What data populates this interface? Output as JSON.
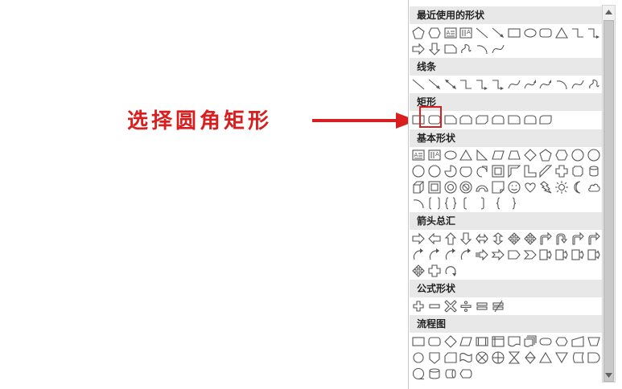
{
  "annotation": {
    "text": "选择圆角矩形",
    "color": "#d81e1e"
  },
  "panel": {
    "sections": [
      {
        "title": "最近使用的形状",
        "rows": [
          [
            "pentagon-icon",
            "hexagon-icon",
            "text-box-icon",
            "vertical-text-box-icon",
            "line-icon",
            "arrow-line-icon",
            "rectangle-icon",
            "oval-icon",
            "rounded-rectangle-icon",
            "triangle-icon",
            "elbow-connector-icon",
            "elbow-arrow-connector-icon"
          ],
          [
            "right-arrow-icon",
            "down-arrow-icon",
            "snip-corner-rectangle-icon",
            "scribble-icon",
            "arc-icon",
            "freeform-curve-icon"
          ]
        ]
      },
      {
        "title": "线条",
        "rows": [
          [
            "line-icon",
            "arrow-line-icon",
            "double-arrow-line-icon",
            "elbow-connector-icon",
            "elbow-arrow-connector-icon",
            "elbow-double-arrow-icon",
            "curved-connector-icon",
            "curved-arrow-connector-icon",
            "curved-double-arrow-icon",
            "curve-icon",
            "freeform-icon",
            "scribble-icon"
          ]
        ]
      },
      {
        "title": "矩形",
        "rows": [
          [
            "rectangle-icon",
            "rounded-rectangle-icon",
            "snip-single-corner-icon",
            "snip-same-side-icon",
            "snip-diagonal-icon",
            "snip-round-corner-icon",
            "round-single-corner-icon",
            "round-same-side-icon",
            "round-diagonal-icon"
          ]
        ]
      },
      {
        "title": "基本形状",
        "rows": [
          [
            "text-box-icon",
            "vertical-text-box-icon",
            "oval-icon",
            "isosceles-triangle-icon",
            "right-triangle-icon",
            "parallelogram-icon",
            "trapezoid-icon",
            "diamond-icon",
            "pentagon-icon",
            "hexagon-icon",
            "heptagon-icon",
            "octagon-icon"
          ],
          [
            "decagon-icon",
            "dodecagon-icon",
            "pie-icon",
            "chord-icon",
            "teardrop-icon",
            "frame-icon",
            "half-frame-icon",
            "l-shape-icon",
            "diagonal-stripe-icon",
            "cross-icon",
            "plaque-icon",
            "can-icon"
          ],
          [
            "cube-icon",
            "bevel-icon",
            "donut-icon",
            "no-symbol-icon",
            "block-arc-icon",
            "folded-corner-icon",
            "smiley-face-icon",
            "heart-icon",
            "lightning-bolt-icon",
            "sun-icon",
            "moon-icon",
            "cloud-icon"
          ],
          [
            "arc-icon",
            "double-bracket-icon",
            "double-brace-icon",
            "left-bracket-icon",
            "right-bracket-icon",
            "left-brace-icon",
            "right-brace-icon"
          ]
        ]
      },
      {
        "title": "箭头总汇",
        "rows": [
          [
            "right-arrow-icon",
            "left-arrow-icon",
            "up-arrow-icon",
            "down-arrow-icon",
            "left-right-arrow-icon",
            "up-down-arrow-icon",
            "quad-arrow-icon",
            "left-right-up-arrow-icon",
            "bent-arrow-icon",
            "u-turn-arrow-icon",
            "left-up-arrow-icon",
            "bent-up-arrow-icon"
          ],
          [
            "curved-right-arrow-icon",
            "curved-left-arrow-icon",
            "curved-up-arrow-icon",
            "curved-down-arrow-icon",
            "striped-right-arrow-icon",
            "notched-right-arrow-icon",
            "pentagon-arrow-icon",
            "chevron-icon",
            "right-arrow-callout-icon",
            "down-arrow-callout-icon",
            "left-arrow-callout-icon",
            "up-arrow-callout-icon"
          ],
          [
            "left-right-arrow-callout-icon",
            "quad-arrow-callout-icon",
            "circular-arrow-icon"
          ]
        ]
      },
      {
        "title": "公式形状",
        "rows": [
          [
            "plus-icon",
            "minus-icon",
            "multiply-icon",
            "divide-icon",
            "equal-icon",
            "not-equal-icon"
          ]
        ]
      },
      {
        "title": "流程图",
        "rows": [
          [
            "flowchart-process-icon",
            "flowchart-alternate-process-icon",
            "flowchart-decision-icon",
            "flowchart-data-icon",
            "flowchart-predefined-process-icon",
            "flowchart-internal-storage-icon",
            "flowchart-document-icon",
            "flowchart-multidocument-icon",
            "flowchart-terminator-icon",
            "flowchart-preparation-icon",
            "flowchart-manual-input-icon",
            "flowchart-manual-operation-icon"
          ],
          [
            "flowchart-connector-icon",
            "flowchart-offpage-connector-icon",
            "flowchart-card-icon",
            "flowchart-punched-tape-icon",
            "flowchart-summing-junction-icon",
            "flowchart-or-icon",
            "flowchart-collate-icon",
            "flowchart-sort-icon",
            "flowchart-extract-icon",
            "flowchart-merge-icon",
            "flowchart-stored-data-icon",
            "flowchart-delay-icon"
          ],
          [
            "flowchart-sequential-access-icon",
            "flowchart-magnetic-disk-icon",
            "flowchart-direct-access-icon",
            "flowchart-display-icon"
          ]
        ]
      }
    ]
  }
}
